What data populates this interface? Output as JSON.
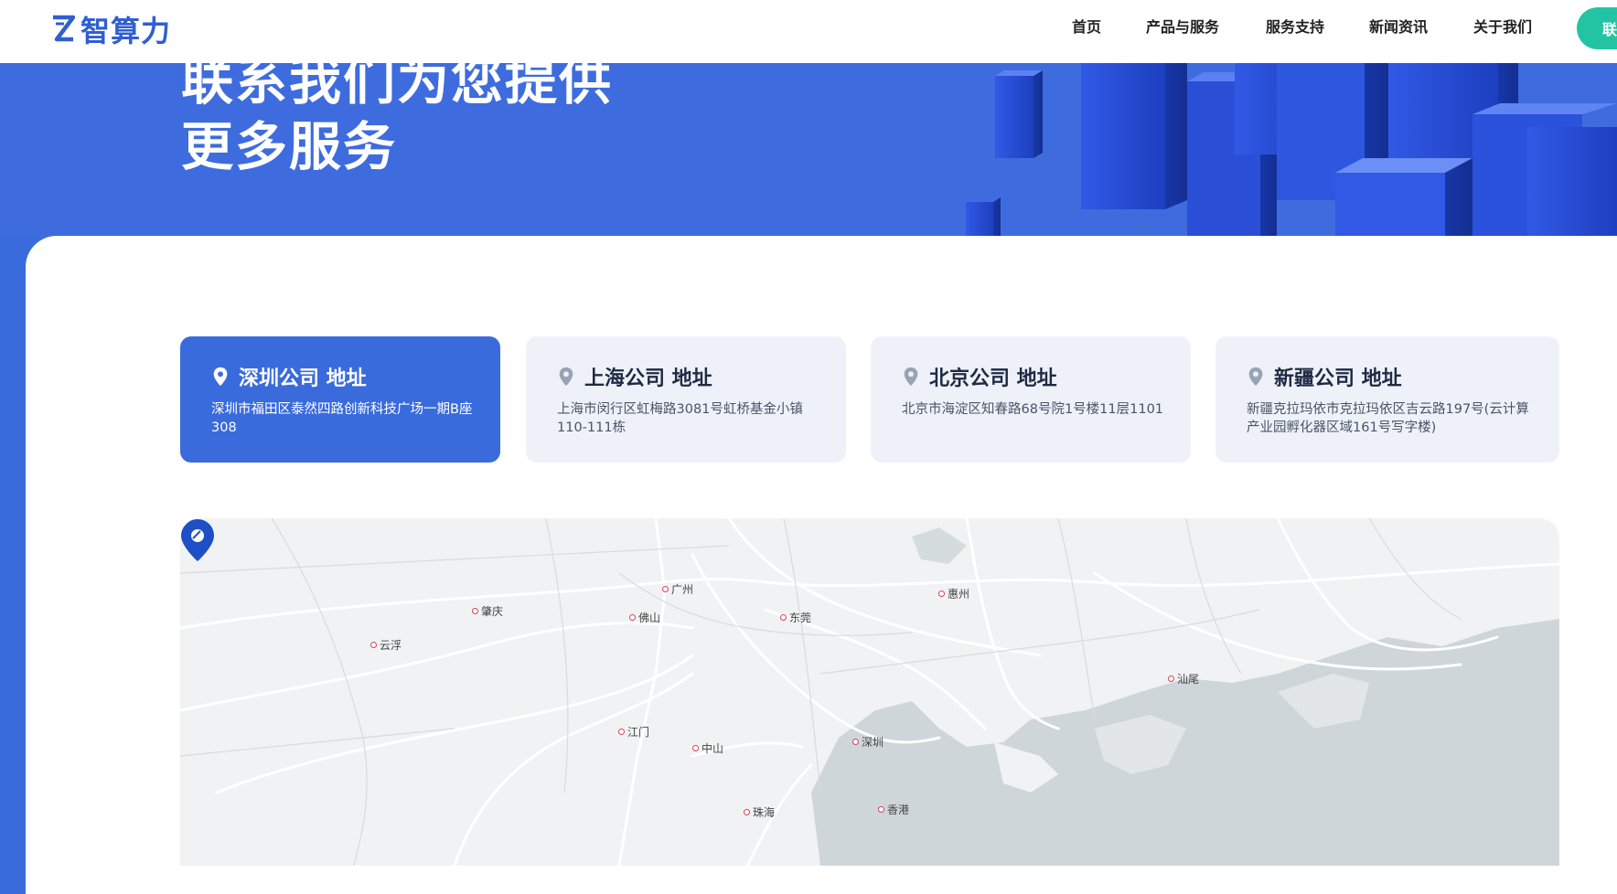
{
  "brand": {
    "name": "智算力",
    "color": "#2f5fd0",
    "accent": "#23c4a4"
  },
  "nav": {
    "items": [
      "首页",
      "产品与服务",
      "服务支持",
      "新闻资讯",
      "关于我们"
    ],
    "contact_label": "联"
  },
  "hero": {
    "title_line1": "联系我们为您提供",
    "title_line2": "更多服务"
  },
  "offices": [
    {
      "title": "深圳公司 地址",
      "address": "深圳市福田区泰然四路创新科技广场一期B座308",
      "active": true
    },
    {
      "title": "上海公司 地址",
      "address": "上海市闵行区虹梅路3081号虹桥基金小镇110-111栋",
      "active": false
    },
    {
      "title": "北京公司 地址",
      "address": "北京市海淀区知春路68号院1号楼11层1101",
      "active": false
    },
    {
      "title": "新疆公司 地址",
      "address": "新疆克拉玛依市克拉玛依区吉云路197号(云计算产业园孵化器区域161号写字楼)",
      "active": false
    }
  ],
  "map": {
    "cities": [
      "广州",
      "肇庆",
      "佛山",
      "东莞",
      "惠州",
      "云浮",
      "汕尾",
      "江门",
      "中山",
      "深圳",
      "珠海",
      "香港"
    ],
    "marker_icon": "map-pin-icon"
  }
}
